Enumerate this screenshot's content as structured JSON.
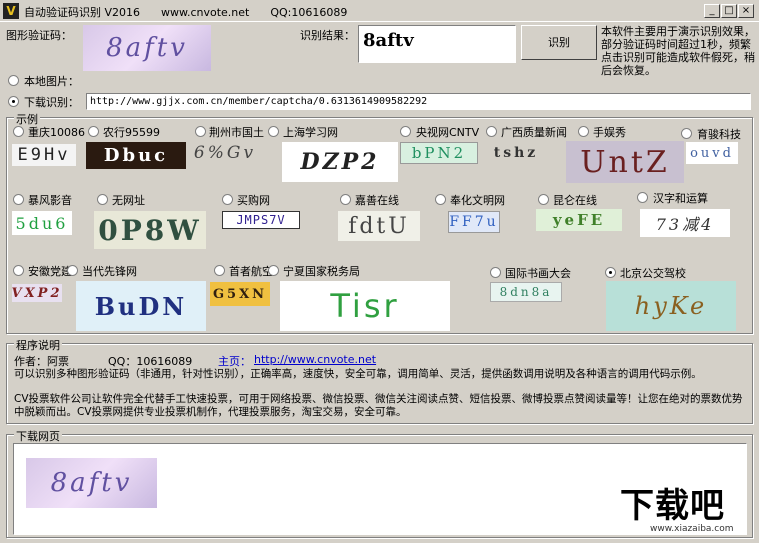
{
  "window": {
    "title": "自动验证码识别 V2016      www.cnvote.net      QQ:10616089"
  },
  "top": {
    "captcha_label": "图形验证码：",
    "captcha_text": "8aftv",
    "result_label": "识别结果：",
    "result_value": "8aftv",
    "recognize_button": "识别",
    "notice": "本软件主要用于演示识别效果，部分验证码时间超过1秒，频繁点击识别可能造成软件假死，稍后会恢复。",
    "local_label": "本地图片：",
    "download_label": "下载识别：",
    "url": "http://www.gjjx.com.cn/member/captcha/0.6313614909582292"
  },
  "examples": {
    "title": "示例",
    "items": [
      {
        "label": "重庆10086",
        "cap": "E9Hv"
      },
      {
        "label": "农行95599",
        "cap": "Dbuc"
      },
      {
        "label": "荆州市国土",
        "cap": "6%Gv"
      },
      {
        "label": "上海学习网",
        "cap": "DZP2"
      },
      {
        "label": "央视网CNTV",
        "cap": "bPN2"
      },
      {
        "label": "广西质量新闻",
        "cap": "tshz"
      },
      {
        "label": "手娱秀",
        "cap": "UntZ"
      },
      {
        "label": "育骏科技",
        "cap": "ouvd"
      },
      {
        "label": "暴风影音",
        "cap": "5du6"
      },
      {
        "label": "无网址",
        "cap": "0P8W"
      },
      {
        "label": "买购网",
        "cap": "JMPS7V"
      },
      {
        "label": "嘉善在线",
        "cap": "fdtU"
      },
      {
        "label": "奉化文明网",
        "cap": "FF7u"
      },
      {
        "label": "昆仑在线",
        "cap": "yeFE"
      },
      {
        "label": "汉字和运算",
        "cap": "73减4"
      },
      {
        "label": "安徽党建",
        "cap": "VXP2"
      },
      {
        "label": "当代先锋网",
        "cap": "BuDN"
      },
      {
        "label": "首者航空",
        "cap": "G5XN"
      },
      {
        "label": "宁夏国家税务局",
        "cap": "Tisr"
      },
      {
        "label": "国际书画大会",
        "cap": "8dn8a"
      },
      {
        "label": "北京公交驾校",
        "cap": "hyKe"
      }
    ]
  },
  "program": {
    "title": "程序说明",
    "author_label": "作者：阿票",
    "qq": "QQ：10616089",
    "home_label": "主页：",
    "home_url": "http://www.cnvote.net",
    "desc1": "可以识别多种图形验证码（非通用，针对性识别），正确率高，速度快，安全可靠，调用简单、灵活，提供函数调用说明及各种语言的调用代码示例。",
    "desc2": "CV投票软件公司让软件完全代替手工快速投票，可用于网络投票、微信投票、微信关注阅读点赞、短信投票、微博投票点赞阅读量等！让您在绝对的票数优势中脱颖而出。CV投票网提供专业投票机制作，代理投票服务，淘宝交易，安全可靠。"
  },
  "download": {
    "title": "下载网页",
    "cap": "8aftv"
  },
  "watermark": {
    "text": "下载吧",
    "url": "www.xiazaiba.com"
  }
}
